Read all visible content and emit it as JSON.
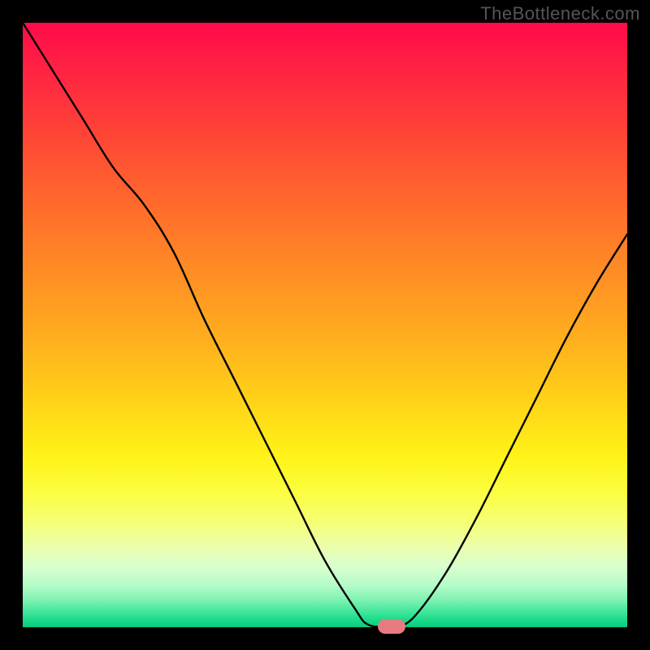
{
  "watermark": "TheBottleneck.com",
  "colors": {
    "frame": "#000000",
    "curve": "#000000",
    "marker": "#e77b7f",
    "gradient_top": "#ff0b4a",
    "gradient_bottom": "#0cc97e"
  },
  "chart_data": {
    "type": "line",
    "title": "",
    "xlabel": "",
    "ylabel": "",
    "xlim": [
      0,
      100
    ],
    "ylim": [
      0,
      100
    ],
    "x": [
      0,
      5,
      10,
      15,
      20,
      25,
      30,
      35,
      40,
      45,
      50,
      55,
      57,
      60,
      62,
      65,
      70,
      75,
      80,
      85,
      90,
      95,
      100
    ],
    "y": [
      100,
      92,
      84,
      76,
      70,
      62,
      51,
      41,
      31,
      21,
      11,
      3,
      0.5,
      0,
      0,
      2,
      9,
      18,
      28,
      38,
      48,
      57,
      65
    ],
    "min_x": 60,
    "min_y": 0,
    "notes": "V-shaped bottleneck curve; minimum (optimal pairing) around x≈60 with a small flat zero-region; left branch steeper than right; y reads as bottleneck % where 0 is ideal and 100 is worst."
  },
  "marker": {
    "x_percent": 61,
    "y_percent": 0
  }
}
